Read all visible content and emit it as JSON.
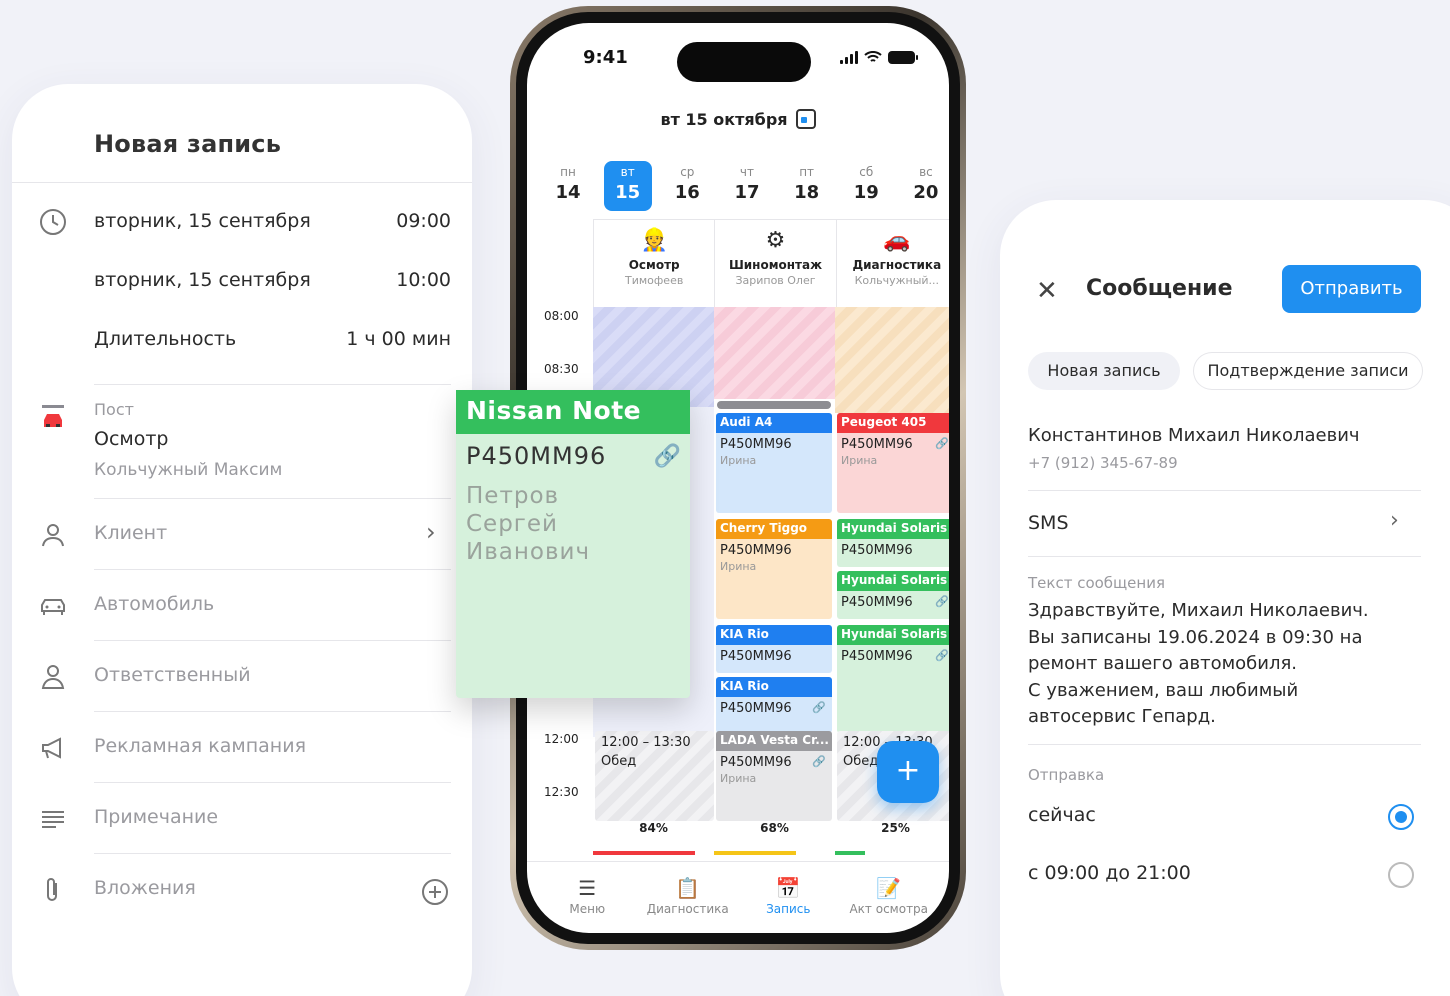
{
  "left_card": {
    "title": "Новая запись",
    "start": {
      "date": "вторник, 15 сентября",
      "time": "09:00"
    },
    "end": {
      "date": "вторник, 15 сентября",
      "time": "10:00"
    },
    "duration": {
      "label": "Длительность",
      "value": "1 ч 00 мин"
    },
    "post": {
      "label": "Пост",
      "name": "Осмотр",
      "person": "Кольчужный Максим"
    },
    "items": [
      {
        "label": "Клиент",
        "icon": "person-icon"
      },
      {
        "label": "Автомобиль",
        "icon": "car-icon"
      },
      {
        "label": "Ответственный",
        "icon": "worker-icon"
      },
      {
        "label": "Рекламная кампания",
        "icon": "megaphone-icon"
      },
      {
        "label": "Примечание",
        "icon": "note-lines-icon"
      },
      {
        "label": "Вложения",
        "icon": "paperclip-icon"
      }
    ]
  },
  "phone": {
    "time": "9:41",
    "header_date": "вт 15 октября",
    "week": [
      {
        "wd": "пн",
        "dn": "14"
      },
      {
        "wd": "вт",
        "dn": "15"
      },
      {
        "wd": "ср",
        "dn": "16"
      },
      {
        "wd": "чт",
        "dn": "17"
      },
      {
        "wd": "пт",
        "dn": "18"
      },
      {
        "wd": "сб",
        "dn": "19"
      },
      {
        "wd": "вс",
        "dn": "20"
      }
    ],
    "posts": [
      {
        "name": "Осмотр",
        "master": "Тимофеев",
        "icon": "mechanic-icon"
      },
      {
        "name": "Шиномонтаж",
        "master": "Зарипов Олег",
        "icon": "tire-icon"
      },
      {
        "name": "Диагностика",
        "master": "Кольчужный...",
        "icon": "car-lift-icon"
      }
    ],
    "times": [
      "08:00",
      "08:30",
      "12:00",
      "12:30"
    ],
    "events": {
      "audi": {
        "title": "Audi A4",
        "plate": "Р450ММ96",
        "master": "Ирина"
      },
      "peugeot": {
        "title": "Peugeot 405",
        "plate": "Р450ММ96",
        "master": "Ирина"
      },
      "cherry": {
        "title": "Cherry Tiggo",
        "plate": "Р450ММ96",
        "master": "Ирина"
      },
      "solaris1": {
        "title": "Hyundai Solaris",
        "plate": "Р450ММ96"
      },
      "solaris2": {
        "title": "Hyundai Solaris",
        "plate": "Р450ММ96"
      },
      "solaris3": {
        "title": "Hyundai Solaris",
        "plate": "Р450ММ96"
      },
      "kia1": {
        "title": "KIA Rio",
        "plate": "Р450ММ96"
      },
      "kia2": {
        "title": "KIA Rio",
        "plate": "Р450ММ96"
      },
      "lada": {
        "title": "LADA Vesta Cr...",
        "plate": "Р450ММ96",
        "master": "Ирина"
      },
      "lunch1": {
        "time": "12:00 – 13:30",
        "label": "Обед"
      },
      "lunch3": {
        "time": "12:00 – 13:30",
        "label": "Обед"
      }
    },
    "loads": [
      {
        "value": "84%",
        "color": "#f0383d",
        "fraction": 0.84
      },
      {
        "value": "68%",
        "color": "#f5c518",
        "fraction": 0.68
      },
      {
        "value": "25%",
        "color": "#34bf5d",
        "fraction": 0.25
      }
    ],
    "fab": "+",
    "tabs": [
      {
        "label": "Меню",
        "icon": "menu-icon"
      },
      {
        "label": "Диагностика",
        "icon": "clipboard-icon"
      },
      {
        "label": "Запись",
        "icon": "calendar-plus-icon"
      },
      {
        "label": "Акт осмотра",
        "icon": "document-icon"
      }
    ]
  },
  "floating_card": {
    "title": "Nissan Note",
    "plate": "Р450ММ96",
    "name_lines": [
      "Петров",
      "Сергей",
      "Иванович"
    ]
  },
  "right_card": {
    "title": "Сообщение",
    "send": "Отправить",
    "chips": [
      "Новая запись",
      "Подтверждение записи"
    ],
    "client_name": "Константинов Михаил Николаевич",
    "client_phone": "+7 (912) 345-67-89",
    "channel": "SMS",
    "message_label": "Текст сообщения",
    "message_lines": [
      "Здравствуйте, Михаил Николаевич.",
      "Вы записаны 19.06.2024 в 09:30 на",
      "ремонт вашего автомобиля.",
      "С уважением, ваш любимый",
      "автосервис Гепард."
    ],
    "sending_label": "Отправка",
    "options": [
      "сейчас",
      "с 09:00 до 21:00"
    ]
  }
}
